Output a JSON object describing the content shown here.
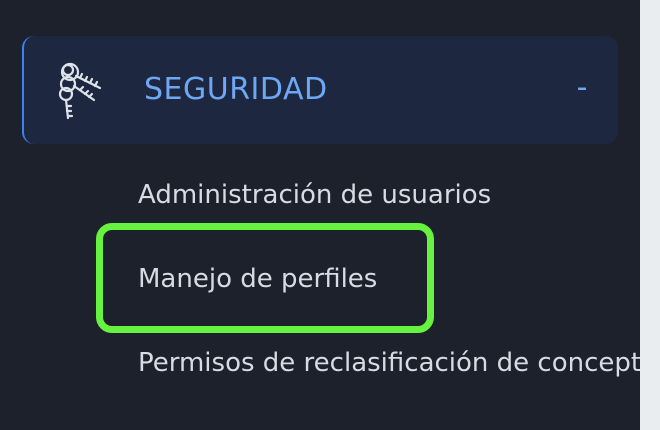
{
  "sidebar": {
    "section": {
      "title": "SEGURIDAD",
      "toggle": "-",
      "icon": "keys-icon"
    },
    "items": [
      {
        "label": "Administración de usuarios"
      },
      {
        "label": "Manejo de perfiles"
      },
      {
        "label": "Permisos de reclasificación de conceptos"
      }
    ]
  },
  "colors": {
    "background": "#1c212c",
    "header_background": "#1d2840",
    "accent": "#6ea8f5",
    "highlight": "#66f23f",
    "gutter": "#eaedf0"
  }
}
